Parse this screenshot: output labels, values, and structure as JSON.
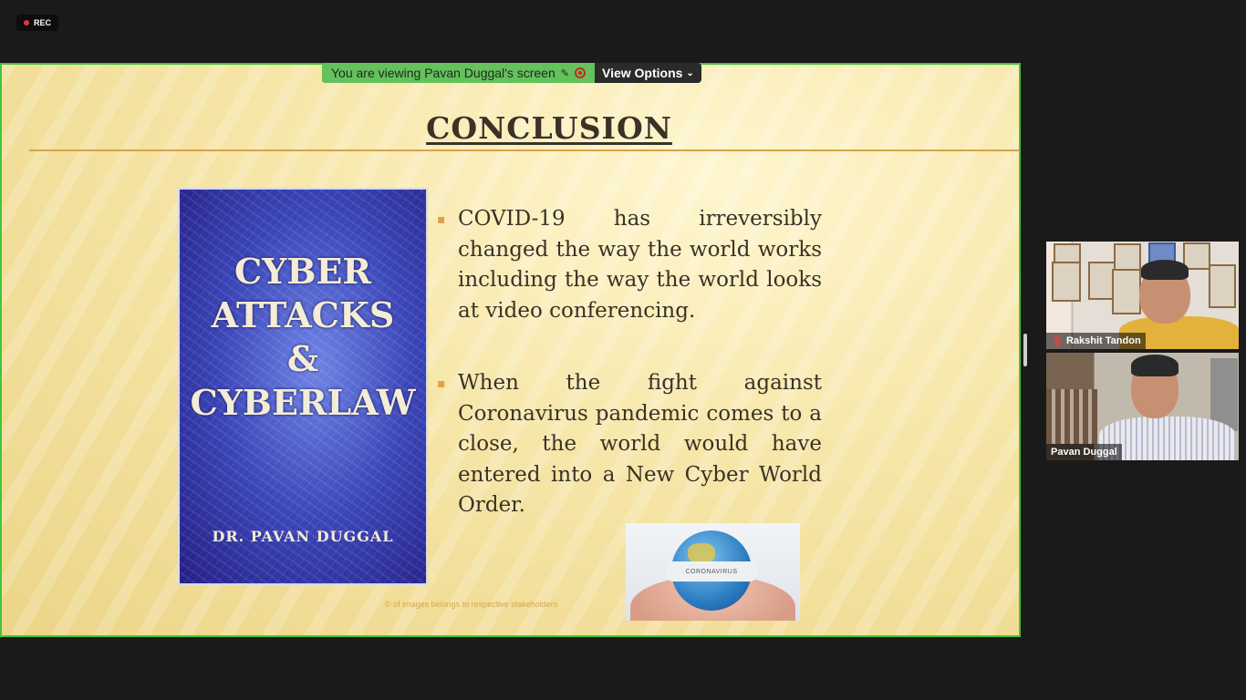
{
  "recording": {
    "label": "REC"
  },
  "share_banner": {
    "text": "You are viewing Pavan Duggal's screen",
    "view_options": "View Options"
  },
  "slide": {
    "title": "CONCLUSION",
    "book": {
      "title_lines": [
        "CYBER",
        "ATTACKS",
        "&",
        "CYBERLAW"
      ],
      "author": "DR. PAVAN DUGGAL"
    },
    "bullets": [
      "COVID-19 has irreversibly changed the way the world works including the way the world looks at video conferencing.",
      "When the fight against Coronavirus pandemic comes to a close, the world would have entered into a New Cyber World Order."
    ],
    "credit": "© of images belongs to respective stakeholders",
    "globe_mask_text": "CORONAVIRUS"
  },
  "participants": [
    {
      "name": "Rakshit Tandon",
      "muted": true
    },
    {
      "name": "Pavan Duggal",
      "muted": false
    }
  ],
  "colors": {
    "share_border": "#43c43a",
    "banner": "#64c15c",
    "muted": "#e24040"
  }
}
